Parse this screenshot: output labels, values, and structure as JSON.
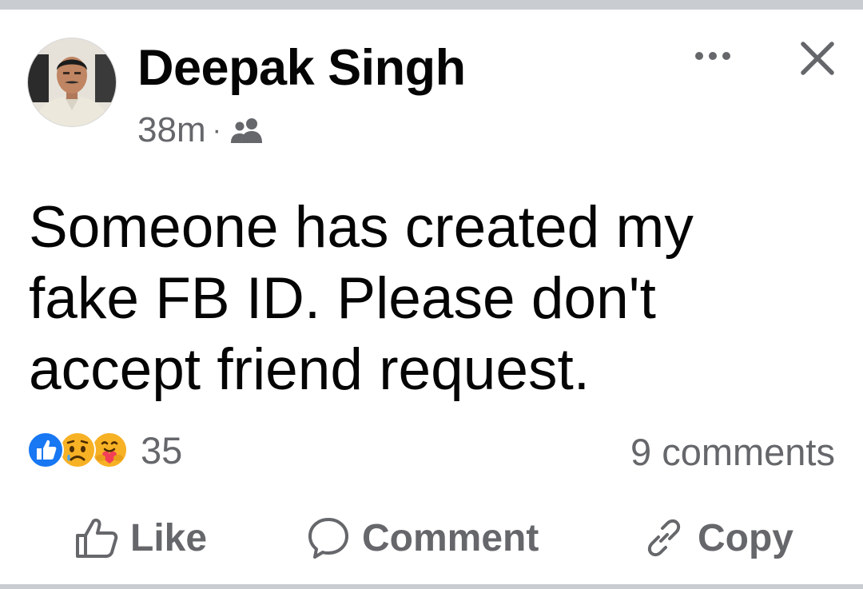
{
  "post": {
    "author": "Deepak Singh",
    "time": "38m",
    "separator": "·",
    "audience_icon": "friends-audience-icon",
    "text": "Someone has created my\nfake FB ID.  Please don't\naccept friend request.",
    "reaction_icons": [
      "like-reaction-icon",
      "sad-reaction-icon",
      "care-reaction-icon"
    ],
    "reaction_count": "35",
    "comments_count": "9 comments"
  },
  "actions": {
    "like_label": "Like",
    "comment_label": "Comment",
    "copy_label": "Copy"
  },
  "header_icons": [
    "more-options-icon",
    "close-icon"
  ],
  "colors": {
    "primary_text": "#050505",
    "secondary_text": "#65676b",
    "like_blue": "#1877f2",
    "divider": "#c9ccd1"
  }
}
